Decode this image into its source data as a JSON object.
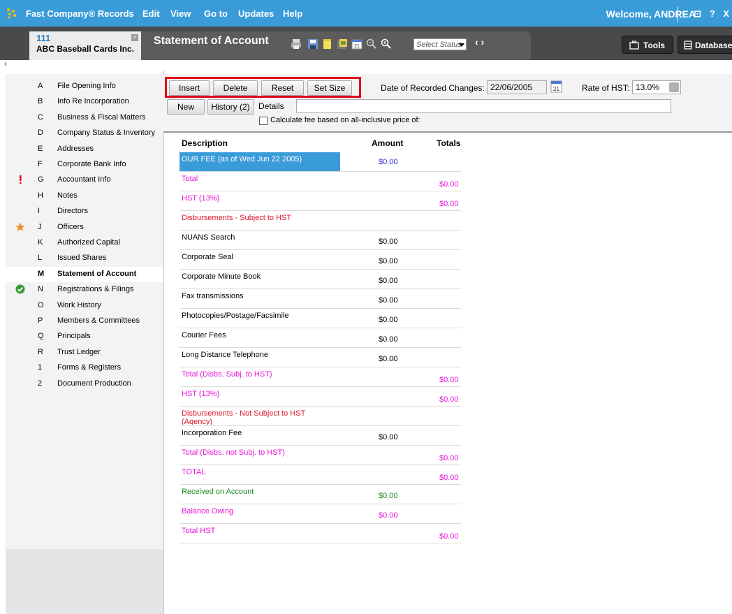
{
  "menubar": {
    "items": [
      "Fast Company® Records",
      "Edit",
      "View",
      "Go to",
      "Updates",
      "Help"
    ],
    "welcome": "Welcome, ANDREA",
    "window_controls": "- ⊡ ? X"
  },
  "file_tab": {
    "number": "111",
    "name": "ABC Baseball Cards Inc.",
    "close": "×"
  },
  "document": {
    "title": "Statement of Account",
    "status_placeholder": "Select Status",
    "nav_arrows": "‹ ›"
  },
  "top_buttons": {
    "tools": "Tools",
    "databases": "Databases"
  },
  "collapse_glyph": "‹",
  "sidebar": {
    "items": [
      {
        "letter": "A",
        "label": "File Opening Info"
      },
      {
        "letter": "B",
        "label": "Info Re Incorporation"
      },
      {
        "letter": "C",
        "label": "Business & Fiscal Matters"
      },
      {
        "letter": "D",
        "label": "Company Status & Inventory"
      },
      {
        "letter": "E",
        "label": "Addresses"
      },
      {
        "letter": "F",
        "label": "Corporate Bank Info"
      },
      {
        "letter": "G",
        "label": "Accountant Info",
        "mark": "exclamation-icon"
      },
      {
        "letter": "H",
        "label": "Notes"
      },
      {
        "letter": "I",
        "label": "Directors"
      },
      {
        "letter": "J",
        "label": "Officers",
        "mark": "star-icon"
      },
      {
        "letter": "K",
        "label": "Authorized Capital"
      },
      {
        "letter": "L",
        "label": "Issued Shares"
      },
      {
        "letter": "M",
        "label": "Statement of Account",
        "active": true
      },
      {
        "letter": "N",
        "label": "Registrations & Filings",
        "mark": "check-icon"
      },
      {
        "letter": "O",
        "label": "Work History"
      },
      {
        "letter": "P",
        "label": "Members & Committees"
      },
      {
        "letter": "Q",
        "label": "Principals"
      },
      {
        "letter": "R",
        "label": "Trust Ledger"
      },
      {
        "letter": "1",
        "label": "Forms & Registers"
      },
      {
        "letter": "2",
        "label": "Document Production"
      }
    ]
  },
  "form": {
    "insert": "Insert",
    "delete": "Delete",
    "reset": "Reset",
    "set_size": "Set Size",
    "date_label": "Date of Recorded Changes:",
    "date_value": "22/06/2005",
    "calendar_day": "21",
    "hst_rate_label": "Rate of HST:",
    "hst_rate_value": "13.0%",
    "new": "New",
    "history": "History (2)",
    "details_label": "Details",
    "details_value": "",
    "calc_checkbox_label": "Calculate fee based on all-inclusive price of:"
  },
  "table": {
    "headers": {
      "description": "Description",
      "amount": "Amount",
      "totals": "Totals"
    },
    "rows": [
      {
        "desc": "OUR FEE (as of Wed Jun 22 2005)",
        "amount": "$0.00",
        "total": "",
        "color": "white",
        "amount_color": "blue",
        "highlight": true
      },
      {
        "desc": "Total",
        "amount": "",
        "total": "$0.00",
        "color": "magenta"
      },
      {
        "desc": "HST (13%)",
        "amount": "",
        "total": "$0.00",
        "color": "magenta"
      },
      {
        "desc": "Disbursements - Subject to HST",
        "amount": "",
        "total": "",
        "color": "red"
      },
      {
        "desc": "NUANS Search",
        "amount": "$0.00",
        "total": "",
        "color": "black"
      },
      {
        "desc": "Corporate Seal",
        "amount": "$0.00",
        "total": "",
        "color": "black"
      },
      {
        "desc": "Corporate Minute Book",
        "amount": "$0.00",
        "total": "",
        "color": "black"
      },
      {
        "desc": "Fax transmissions",
        "amount": "$0.00",
        "total": "",
        "color": "black"
      },
      {
        "desc": "Photocopies/Postage/Facsimile",
        "amount": "$0.00",
        "total": "",
        "color": "black"
      },
      {
        "desc": "Courier Fees",
        "amount": "$0.00",
        "total": "",
        "color": "black"
      },
      {
        "desc": "Long Distance Telephone",
        "amount": "$0.00",
        "total": "",
        "color": "black"
      },
      {
        "desc": "Total (Disbs. Subj. to HST)",
        "amount": "",
        "total": "$0.00",
        "color": "magenta"
      },
      {
        "desc": "HST (13%)",
        "amount": "",
        "total": "$0.00",
        "color": "magenta"
      },
      {
        "desc": "Disbursements - Not Subject to HST (Agency)",
        "amount": "",
        "total": "",
        "color": "red"
      },
      {
        "desc": "Incorporation Fee",
        "amount": "$0.00",
        "total": "",
        "color": "black"
      },
      {
        "desc": "Total (Disbs. not Subj. to HST)",
        "amount": "",
        "total": "$0.00",
        "color": "magenta"
      },
      {
        "desc": "TOTAL",
        "amount": "",
        "total": "$0.00",
        "color": "magenta"
      },
      {
        "desc": "Received on Account",
        "amount": "$0.00",
        "total": "",
        "color": "green"
      },
      {
        "desc": "Balance Owing",
        "amount": "$0.00",
        "total": "",
        "color": "magenta",
        "amount_color": "magenta"
      },
      {
        "desc": "Total HST",
        "amount": "",
        "total": "$0.00",
        "color": "magenta"
      }
    ]
  },
  "colors": {
    "menubar": "#3a9bd9",
    "highlight": "#3a9bd9",
    "red_frame": "#e0001a",
    "magenta": "#e814d8",
    "red": "#e0142a",
    "green": "#1d8b1d"
  }
}
